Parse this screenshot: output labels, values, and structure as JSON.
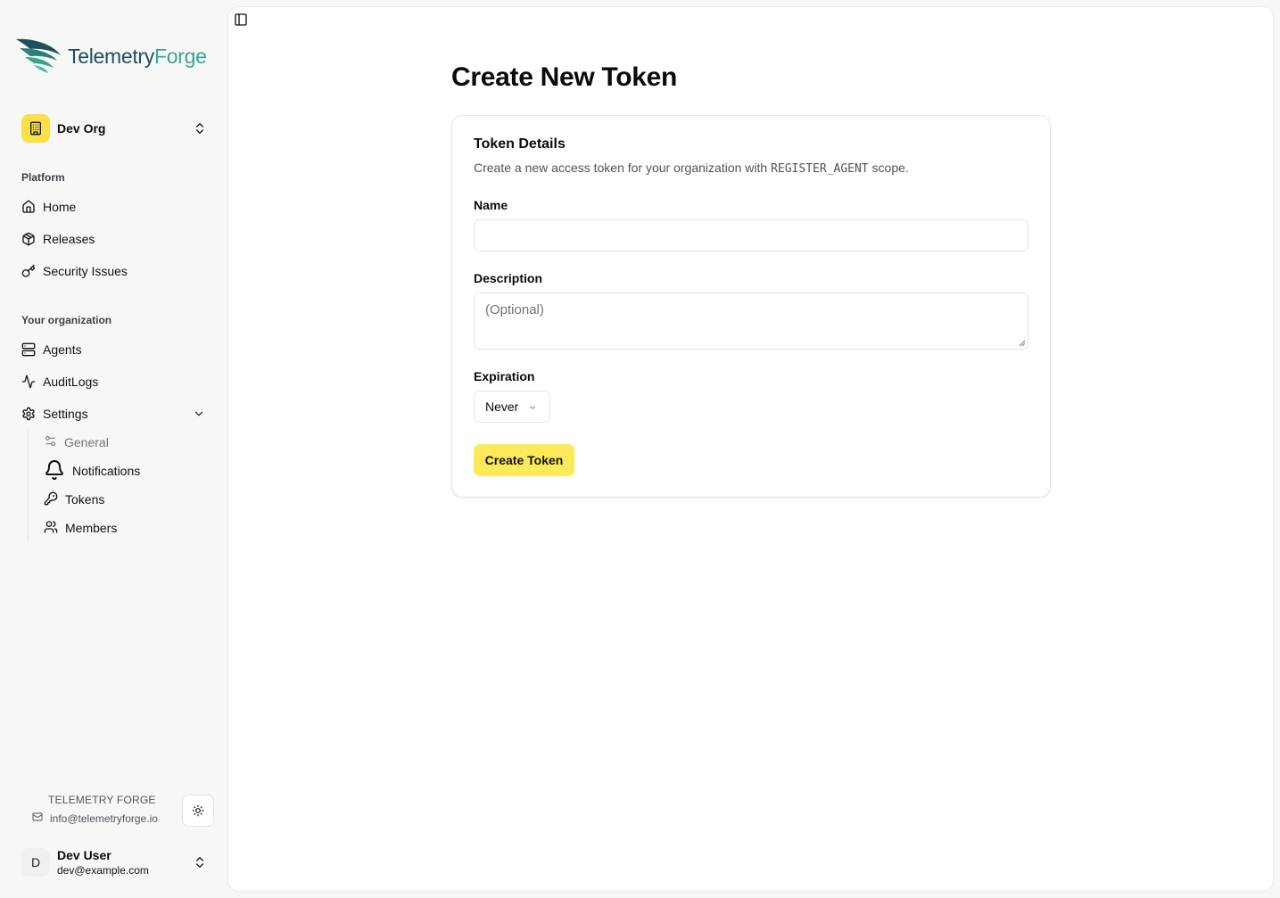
{
  "brand": {
    "name_part1": "Telemetry",
    "name_part2": "Forge",
    "brand_color_dark": "#1e4f5c",
    "brand_color_accent": "#3aa58f"
  },
  "org": {
    "name": "Dev Org",
    "icon": "building-icon",
    "accent": "#fde047"
  },
  "nav": {
    "platform_label": "Platform",
    "platform_items": [
      {
        "label": "Home",
        "icon": "home-icon"
      },
      {
        "label": "Releases",
        "icon": "package-icon"
      },
      {
        "label": "Security Issues",
        "icon": "key-icon"
      }
    ],
    "org_label": "Your organization",
    "org_items": [
      {
        "label": "Agents",
        "icon": "server-icon"
      },
      {
        "label": "AuditLogs",
        "icon": "activity-icon"
      },
      {
        "label": "Settings",
        "icon": "gear-icon"
      }
    ],
    "settings_sub": [
      {
        "label": "General",
        "icon": "sliders-icon"
      },
      {
        "label": "Notifications",
        "icon": "bell-icon"
      },
      {
        "label": "Tokens",
        "icon": "key-icon"
      },
      {
        "label": "Members",
        "icon": "users-icon"
      }
    ]
  },
  "footer": {
    "brand": "TELEMETRY FORGE",
    "email": "info@telemetryforge.io"
  },
  "user": {
    "initial": "D",
    "name": "Dev User",
    "email": "dev@example.com"
  },
  "page": {
    "title": "Create New Token",
    "card": {
      "title": "Token Details",
      "desc_prefix": "Create a new access token for your organization with",
      "desc_code": "REGISTER_AGENT",
      "desc_suffix": "scope.",
      "name_label": "Name",
      "name_value": "",
      "description_label": "Description",
      "description_placeholder": "(Optional)",
      "expiration_label": "Expiration",
      "expiration_value": "Never",
      "submit_label": "Create Token",
      "submit_color": "#fde95a"
    }
  }
}
